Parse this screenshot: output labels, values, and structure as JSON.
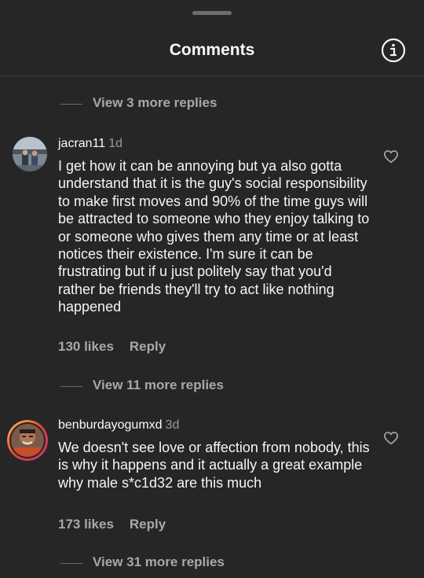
{
  "header": {
    "title": "Comments"
  },
  "replies_top": {
    "label": "View 3 more replies"
  },
  "comments": [
    {
      "username": "jacran11",
      "time": "1d",
      "text": "I get how it can be annoying but ya also gotta understand that it is the guy's social responsibility to make first moves and 90% of the time guys will be attracted to someone who they enjoy talking to or someone who gives them any time or at least notices their existence. I'm sure it can be frustrating but if u just politely say that you'd rather be friends they'll try to act like nothing happened",
      "likes": "130 likes",
      "reply_label": "Reply",
      "replies_label": "View 11 more replies"
    },
    {
      "username": "benburdayogumxd",
      "time": "3d",
      "text": "We doesn't see love or affection from nobody, this is why it happens and it actually a great example why male s*c1d32 are this much",
      "likes": "173 likes",
      "reply_label": "Reply",
      "replies_label": "View 31 more replies"
    }
  ],
  "icons": {
    "info": "info-icon",
    "heart": "heart-icon"
  },
  "colors": {
    "background": "#262626",
    "secondary_text": "#a8a8a8"
  }
}
